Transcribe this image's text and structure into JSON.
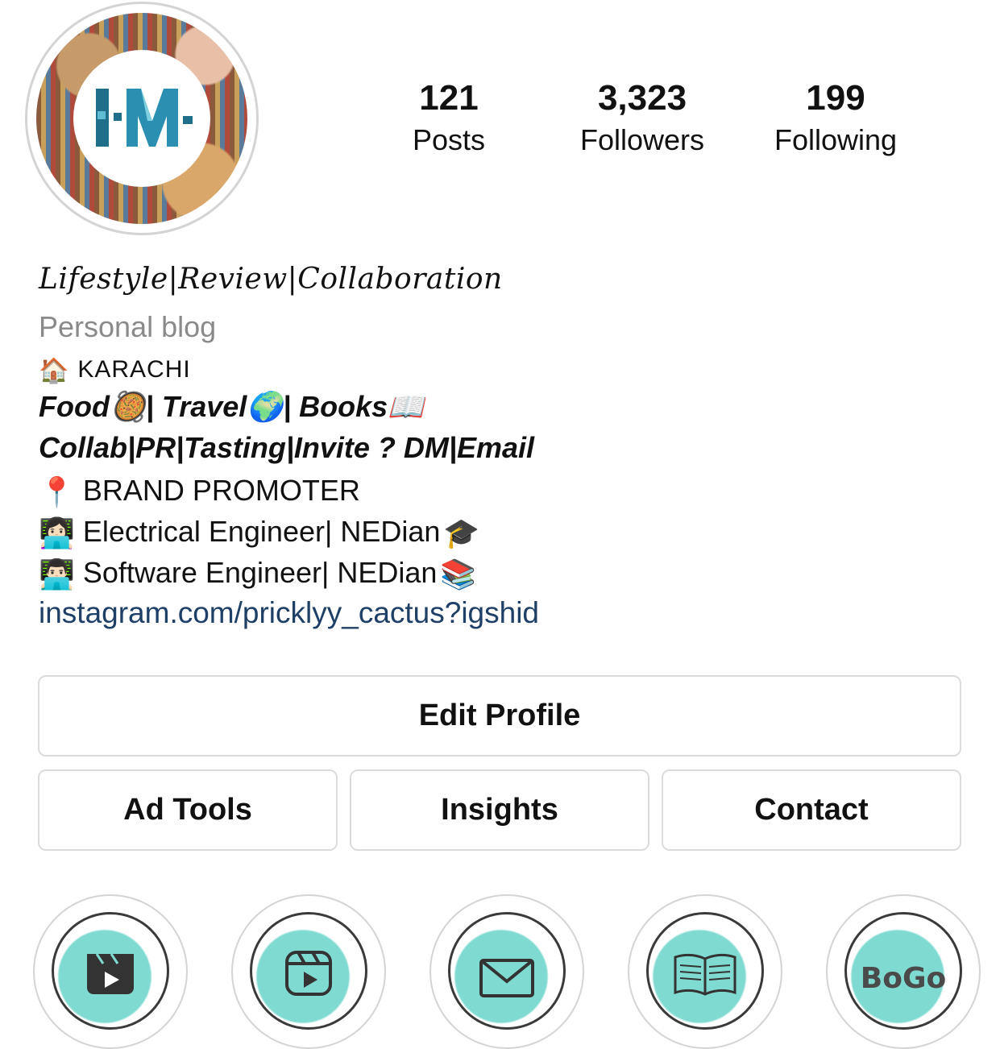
{
  "profile": {
    "avatar_icon": "lm-logo-avatar",
    "avatar_text": "I-M-",
    "stats": {
      "posts": {
        "value": "121",
        "label": "Posts"
      },
      "followers": {
        "value": "3,323",
        "label": "Followers"
      },
      "following": {
        "value": "199",
        "label": "Following"
      }
    }
  },
  "bio": {
    "title": "Lifestyle|Review|Collaboration",
    "category": "Personal blog",
    "location": "KARACHI",
    "interests": "Food🥘| Travel🌍| Books📖",
    "collab": "Collab|PR|Tasting|Invite ? DM|Email",
    "line_brand": "BRAND PROMOTER",
    "line_ee": "Electrical Engineer| NEDian",
    "line_se": "Software Engineer| NEDian",
    "link": "instagram.com/pricklyy_cactus?igshid"
  },
  "buttons": {
    "edit_profile": "Edit Profile",
    "ad_tools": "Ad Tools",
    "insights": "Insights",
    "contact": "Contact"
  },
  "highlights": [
    {
      "icon": "reels-clapper-icon"
    },
    {
      "icon": "reels-play-icon"
    },
    {
      "icon": "mail-icon"
    },
    {
      "icon": "book-icon"
    },
    {
      "icon": "bogo-text-icon",
      "text": "BoGo"
    }
  ],
  "colors": {
    "link": "#1e3f66",
    "muted": "#8a8a8a",
    "border": "#dbdbdb",
    "highlight_teal": "#7fdad1",
    "logo_teal": "#1f6f8b"
  }
}
